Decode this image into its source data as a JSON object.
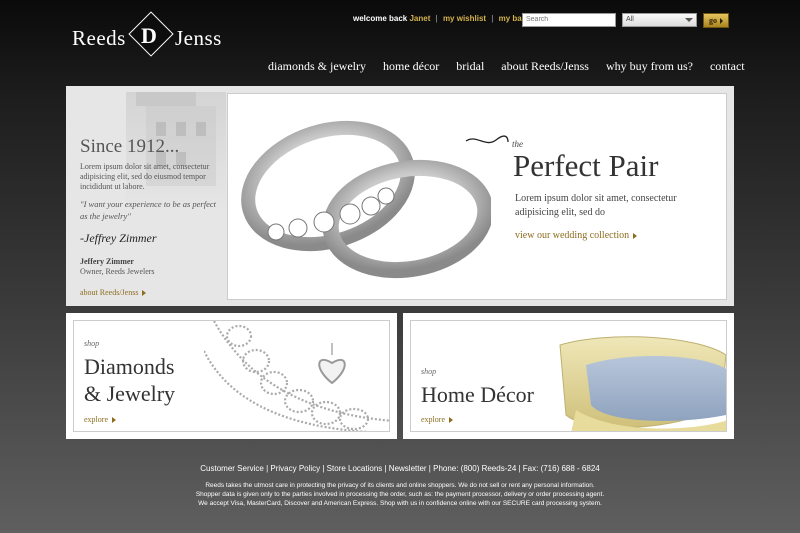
{
  "logo": {
    "left": "Reeds",
    "mono": "D",
    "right": "Jenss"
  },
  "topbar": {
    "welcome": "welcome back",
    "user": "Janet",
    "wishlist": "my wishlist",
    "bag": "my bag",
    "separator": "|"
  },
  "search": {
    "placeholder": "Search",
    "category_selected": "All",
    "go_label": "go"
  },
  "nav": [
    "diamonds & jewelry",
    "home décor",
    "bridal",
    "about Reeds/Jenss",
    "why buy from us?",
    "contact"
  ],
  "hero": {
    "since_title": "Since 1912...",
    "since_body": "Lorem ipsum dolor sit amet, consectetur adipisicing elit, sed do eiusmod tempor incididunt ut labore.",
    "quote": "\"I want your experience to be as perfect as the jewelry\"",
    "signature": "-Jeffrey Zimmer",
    "name": "Jeffery Zimmer",
    "title": "Owner, Reeds Jewelers",
    "about_link": "about Reeds/Jenss",
    "the": "the",
    "headline": "Perfect Pair",
    "body": "Lorem ipsum dolor sit amet, consectetur adipisicing elit, sed do",
    "link": "view our wedding collection"
  },
  "cards": [
    {
      "shop": "shop",
      "title_line1": "Diamonds",
      "title_line2": "& Jewelry",
      "explore": "explore"
    },
    {
      "shop": "shop",
      "title_line1": "Home Décor",
      "title_line2": "",
      "explore": "explore"
    }
  ],
  "footer": {
    "links": "Customer Service | Privacy Policy | Store Locations | Newsletter | Phone: (800) Reeds-24 | Fax: (716) 688 - 6824",
    "line1": "Reeds takes the utmost care in protecting the privacy of its clients and online shoppers. We do not sell or rent any personal information.",
    "line2": "Shopper data is given only to the parties involved in processing the order, such as: the payment processor, delivery or order processing agent.",
    "line3": "We accept Visa, MasterCard, Discover and American Express.  Shop with us in confidence online with our SECURE card processing system."
  },
  "colors": {
    "accent_gold": "#d4b24c",
    "link_gold": "#8c6d1f",
    "background_top": "#0a0a0a",
    "background_bottom": "#5f5f5f"
  }
}
